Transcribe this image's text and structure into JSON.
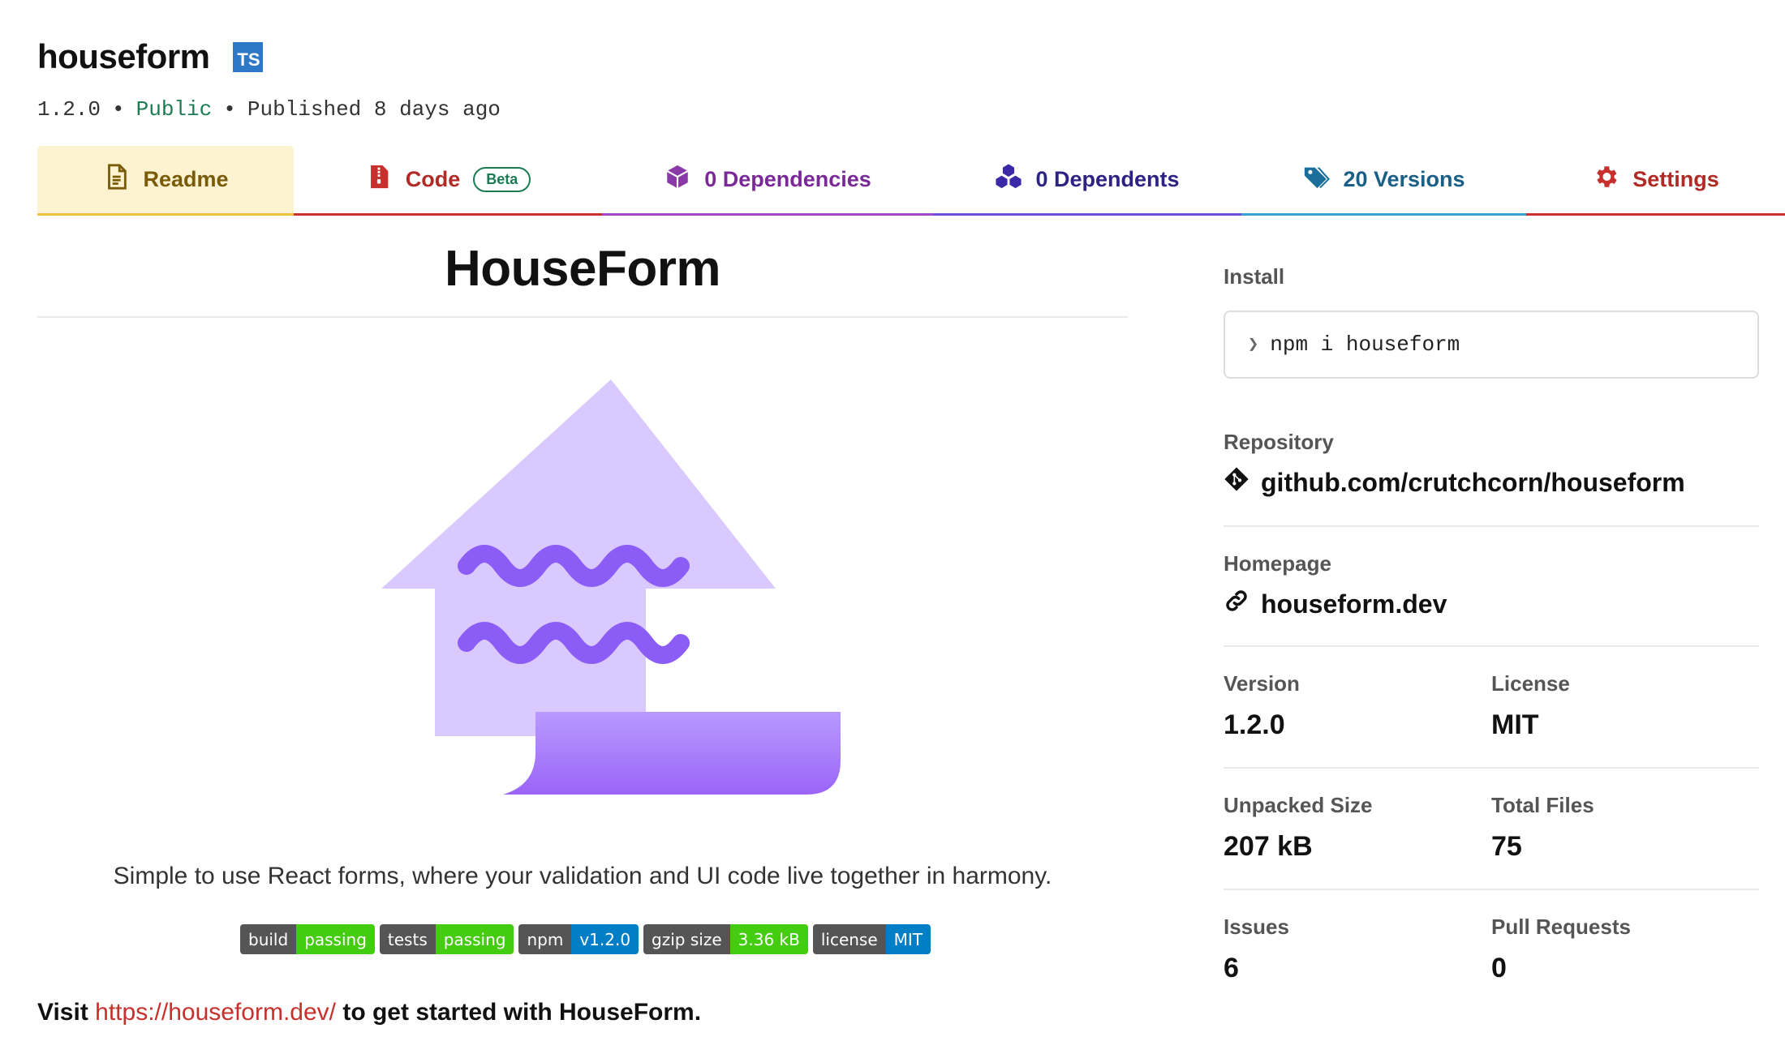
{
  "package": {
    "name": "houseform",
    "ts_badge": "TS",
    "version": "1.2.0",
    "visibility": "Public",
    "published": "Published 8 days ago",
    "separator": "•"
  },
  "tabs": [
    {
      "label": "Readme",
      "icon": "file-text-icon",
      "color": "#7a5b07"
    },
    {
      "label": "Code",
      "icon": "file-zip-icon",
      "badge": "Beta",
      "color": "#b02a26"
    },
    {
      "label": "0 Dependencies",
      "icon": "box-icon",
      "color": "#7a2a96"
    },
    {
      "label": "0 Dependents",
      "icon": "boxes-icon",
      "color": "#2d2382"
    },
    {
      "label": "20 Versions",
      "icon": "tags-icon",
      "color": "#1a5f86"
    },
    {
      "label": "Settings",
      "icon": "gear-icon",
      "color": "#b02a26"
    }
  ],
  "readme": {
    "title": "HouseForm",
    "tagline": "Simple to use React forms, where your validation and UI code live together in harmony.",
    "badges": [
      {
        "left": "build",
        "right": "passing",
        "color": "#44cc11"
      },
      {
        "left": "tests",
        "right": "passing",
        "color": "#44cc11"
      },
      {
        "left": "npm",
        "right": "v1.2.0",
        "color": "#007ec6"
      },
      {
        "left": "gzip size",
        "right": "3.36 kB",
        "color": "#44cc11"
      },
      {
        "left": "license",
        "right": "MIT",
        "color": "#007ec6"
      }
    ],
    "visit_prefix": "Visit",
    "visit_link": "https://houseform.dev/",
    "visit_suffix": "to get started with HouseForm."
  },
  "sidebar": {
    "install_label": "Install",
    "install_prompt": "❯",
    "install_command": "npm i houseform",
    "repository_label": "Repository",
    "repository_value": "github.com/crutchcorn/houseform",
    "homepage_label": "Homepage",
    "homepage_value": "houseform.dev",
    "version_label": "Version",
    "version_value": "1.2.0",
    "license_label": "License",
    "license_value": "MIT",
    "unpacked_label": "Unpacked Size",
    "unpacked_value": "207 kB",
    "files_label": "Total Files",
    "files_value": "75",
    "issues_label": "Issues",
    "issues_value": "6",
    "prs_label": "Pull Requests",
    "prs_value": "0"
  }
}
